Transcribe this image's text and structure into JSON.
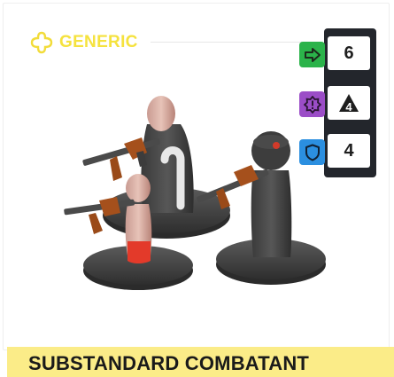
{
  "card": {
    "faction": "GENERIC",
    "name": "SUBSTANDARD COMBATANT",
    "accent_color": "#f5e642",
    "banner_color": "#fbec88"
  },
  "stats": [
    {
      "icon": "move-arrow-icon",
      "badge_color": "#2bb34a",
      "value": "6"
    },
    {
      "icon": "alert-badge-icon",
      "badge_color": "#9b4dc7",
      "value": "4"
    },
    {
      "icon": "shield-icon",
      "badge_color": "#2b8fe0",
      "value": "4"
    }
  ]
}
